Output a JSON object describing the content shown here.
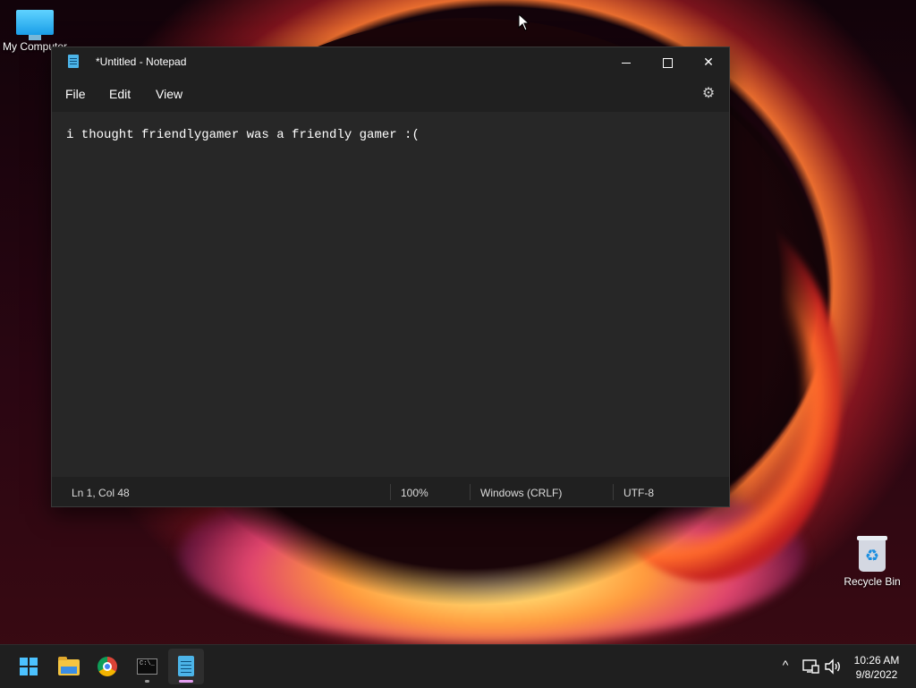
{
  "desktop": {
    "icons": [
      {
        "label": "My Computer"
      },
      {
        "label": "Recycle Bin"
      }
    ]
  },
  "window": {
    "title": "*Untitled - Notepad",
    "menu": [
      "File",
      "Edit",
      "View"
    ],
    "content": "i thought friendlygamer was a friendly gamer :(",
    "status": {
      "position": "Ln 1, Col 48",
      "zoom": "100%",
      "line_ending": "Windows (CRLF)",
      "encoding": "UTF-8"
    }
  },
  "taskbar": {
    "apps": [
      "start-icon",
      "file-explorer-icon",
      "chrome-icon",
      "terminal-icon",
      "notepad-icon"
    ],
    "clock_time": "10:26 AM",
    "clock_date": "9/8/2022"
  },
  "colors": {
    "accent": "#4cc2ff",
    "window_bg": "#202020",
    "editor_bg": "#272727"
  }
}
